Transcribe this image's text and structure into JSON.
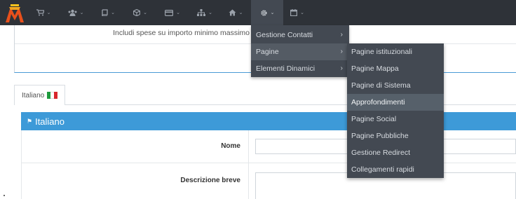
{
  "navbar": {
    "items": [
      {
        "icon": "shopping-cart-icon",
        "caret": "⌄"
      },
      {
        "icon": "users-icon",
        "caret": "⌄"
      },
      {
        "icon": "book-icon",
        "caret": "⌄"
      },
      {
        "icon": "cube-icon",
        "caret": "⌄"
      },
      {
        "icon": "credit-card-icon",
        "caret": "⌄"
      },
      {
        "icon": "sitemap-icon",
        "caret": "⌄"
      },
      {
        "icon": "home-icon",
        "caret": "⌄"
      },
      {
        "icon": "gear-icon",
        "caret": "⌄"
      },
      {
        "icon": "calendar-icon",
        "caret": "⌄"
      }
    ],
    "active_index": 7,
    "colors": {
      "bar": "#2e3238",
      "active": "#434952",
      "icon": "#9aa1aa"
    }
  },
  "page": {
    "includi_label": "Includi spese su importo minimo massimo",
    "lang_tab": {
      "label": "Italiano"
    },
    "section_title": "Italiano",
    "fields": {
      "nome_label": "Nome",
      "descrizione_label": "Descrizione breve"
    },
    "colors": {
      "accent": "#3d9ad8"
    }
  },
  "menu_level1": {
    "items": [
      {
        "label": "Gestione Contatti",
        "chevron": "›"
      },
      {
        "label": "Pagine",
        "chevron": "›"
      },
      {
        "label": "Elementi Dinamici",
        "chevron": "›"
      }
    ]
  },
  "menu_level2": {
    "items": [
      {
        "label": "Pagine istituzionali"
      },
      {
        "label": "Pagine Mappa"
      },
      {
        "label": "Pagine di Sistema"
      },
      {
        "label": "Approfondimenti"
      },
      {
        "label": "Pagine Social"
      },
      {
        "label": "Pagine Pubbliche"
      },
      {
        "label": "Gestione Redirect"
      },
      {
        "label": "Collegamenti rapidi"
      }
    ]
  }
}
